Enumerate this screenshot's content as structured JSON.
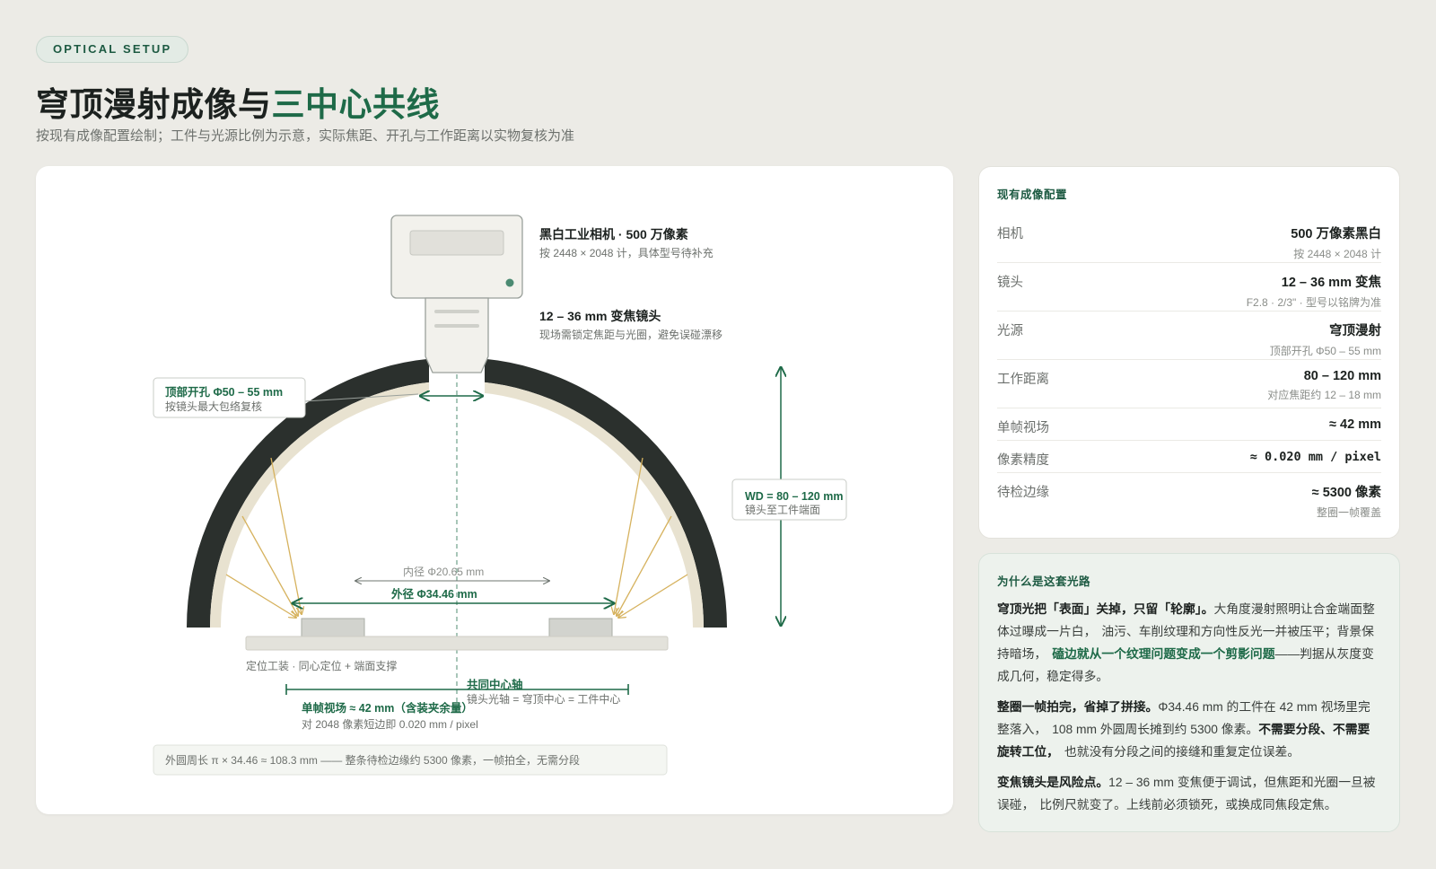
{
  "header": {
    "badge": "OPTICAL SETUP",
    "title_prefix": "穹顶漫射成像与",
    "title_accent": "三中心共线",
    "subtitle": "按现有成像配置绘制；工件与光源比例为示意，实际焦距、开孔与工作距离以实物复核为准"
  },
  "diagram": {
    "camera_label": "黑白工业相机 · 500 万像素",
    "camera_sub": "按 2448 × 2048 计，具体型号待补充",
    "lens_label": "12 – 36 mm 变焦镜头",
    "lens_sub": "现场需锁定焦距与光圈，避免误碰漂移",
    "aperture_label": "顶部开孔 Φ50 – 55 mm",
    "aperture_sub": "按镜头最大包络复核",
    "wd_label": "WD = 80 – 120 mm",
    "wd_sub": "镜头至工件端面",
    "inner_dia": "内径 Φ20.65 mm",
    "outer_dia": "外径 Φ34.46 mm",
    "fixture_label": "定位工装 · 同心定位 + 端面支撑",
    "axis_label": "共同中心轴",
    "axis_sub": "镜头光轴 = 穹顶中心 = 工件中心",
    "fov_label": "单帧视场 ≈ 42 mm（含装夹余量）",
    "fov_sub": "对 2048 像素短边即 0.020 mm / pixel",
    "footnote": "外圆周长 π × 34.46 ≈ 108.3 mm —— 整条待检边缘约 5300 像素，一帧拍全，无需分段"
  },
  "specs": {
    "heading": "现有成像配置",
    "rows": [
      {
        "label": "相机",
        "value": "500 万像素黑白",
        "sub": "按 2448 × 2048 计"
      },
      {
        "label": "镜头",
        "value": "12 – 36 mm 变焦",
        "sub": "F2.8 · 2/3\" · 型号以铭牌为准"
      },
      {
        "label": "光源",
        "value": "穹顶漫射",
        "sub": "顶部开孔 Φ50 – 55 mm"
      },
      {
        "label": "工作距离",
        "value": "80 – 120 mm",
        "sub": "对应焦距约 12 – 18 mm"
      },
      {
        "label": "单帧视场",
        "value": "≈ 42 mm",
        "sub": ""
      },
      {
        "label": "像素精度",
        "value": "≈ 0.020 mm / pixel",
        "sub": ""
      },
      {
        "label": "待检边缘",
        "value": "≈ 5300 像素",
        "sub": "整圈一帧覆盖"
      }
    ]
  },
  "why": {
    "heading": "为什么是这套光路",
    "p1_bold": "穹顶光把「表面」关掉，只留「轮廓」。",
    "p1_a": "大角度漫射照明让合金端面整体过曝成一片白，",
    "p1_b": "油污、车削纹理和方向性反光一并被压平；背景保持暗场，",
    "p1_hl": "磕边就从一个纹理问题变成一个剪影问题",
    "p1_c": "——判据从灰度变成几何，稳定得多。",
    "p2_bold": "整圈一帧拍完，省掉了拼接。",
    "p2_a": "Φ34.46 mm 的工件在 42 mm 视场里完整落入，",
    "p2_b": "108 mm 外圆周长摊到约 5300 像素。",
    "p2_bold2": "不需要分段、不需要旋转工位，",
    "p2_c": "也就没有分段之间的接缝和重复定位误差。",
    "p3_bold": "变焦镜头是风险点。",
    "p3_a": "12 – 36 mm 变焦便于调试，但焦距和光圈一旦被误碰，",
    "p3_b": "比例尺就变了。上线前必须锁死，或换成同焦段定焦。"
  },
  "colors": {
    "accent": "#1e6a48",
    "dome": "#2b302d",
    "dome_liner": "#e8e2d0",
    "light_ray": "#d6b25e",
    "background": "#ecebe6"
  }
}
